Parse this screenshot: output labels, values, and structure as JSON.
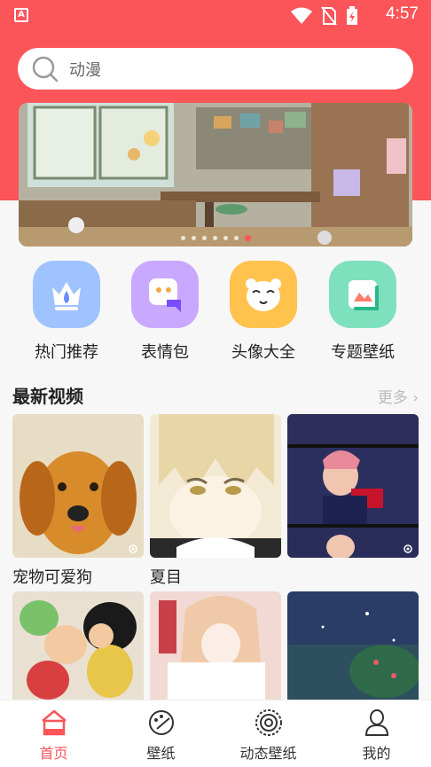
{
  "status_bar": {
    "time": "4:57",
    "app_icon_letter": "A"
  },
  "search": {
    "text": "动漫"
  },
  "banner": {
    "dot_count": 7,
    "active_dot": 6
  },
  "categories": [
    {
      "label": "热门推荐",
      "icon": "crown-flame-icon",
      "color": "#9fc3ff"
    },
    {
      "label": "表情包",
      "icon": "chat-face-icon",
      "color": "#c9a8ff"
    },
    {
      "label": "头像大全",
      "icon": "bear-face-icon",
      "color": "#ffc24d"
    },
    {
      "label": "专题壁纸",
      "icon": "picture-icon",
      "color": "#7fe0be"
    }
  ],
  "section": {
    "title": "最新视频",
    "more": "更多 ›"
  },
  "videos": [
    {
      "caption": "宠物可爱狗"
    },
    {
      "caption": "夏目"
    },
    {
      "caption": ""
    },
    {
      "caption": ""
    },
    {
      "caption": ""
    },
    {
      "caption": ""
    }
  ],
  "tabbar": {
    "active": 0,
    "tabs": [
      {
        "label": "首页",
        "icon": "home-icon"
      },
      {
        "label": "壁纸",
        "icon": "palette-icon"
      },
      {
        "label": "动态壁纸",
        "icon": "dynamic-wallpaper-icon"
      },
      {
        "label": "我的",
        "icon": "profile-icon"
      }
    ]
  },
  "colors": {
    "accent": "#fb5459"
  }
}
